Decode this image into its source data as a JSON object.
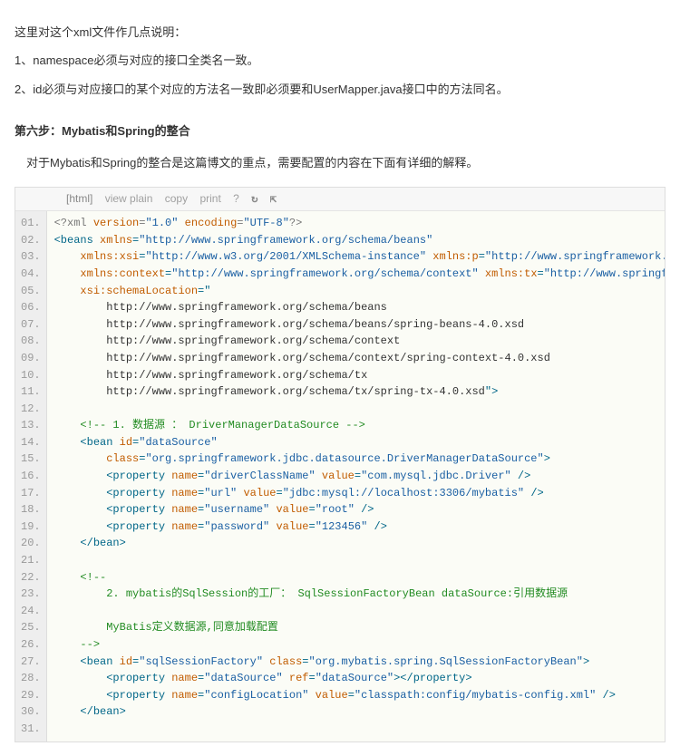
{
  "intro": {
    "line1": "这里对这个xml文件作几点说明：",
    "line2": "1、namespace必须与对应的接口全类名一致。",
    "line3": "2、id必须与对应接口的某个对应的方法名一致即必须要和UserMapper.java接口中的方法同名。"
  },
  "step_title": "第六步：Mybatis和Spring的整合",
  "step_desc": "对于Mybatis和Spring的整合是这篇博文的重点，需要配置的内容在下面有详细的解释。",
  "toolbar": {
    "lang": "[html]",
    "view": "view plain",
    "copy": "copy",
    "print": "print",
    "q": "?",
    "icon1": "↻",
    "icon2": "⇱"
  },
  "code": [
    {
      "n": "01.",
      "tokens": [
        {
          "c": "t-pi",
          "t": "<?xml "
        },
        {
          "c": "t-att",
          "t": "version"
        },
        {
          "c": "t-pi",
          "t": "="
        },
        {
          "c": "t-str",
          "t": "\"1.0\""
        },
        {
          "c": "t-pi",
          "t": " "
        },
        {
          "c": "t-att",
          "t": "encoding"
        },
        {
          "c": "t-pi",
          "t": "="
        },
        {
          "c": "t-str",
          "t": "\"UTF-8\""
        },
        {
          "c": "t-pi",
          "t": "?>"
        }
      ]
    },
    {
      "n": "02.",
      "tokens": [
        {
          "c": "t-tag",
          "t": "<beans "
        },
        {
          "c": "t-att",
          "t": "xmlns"
        },
        {
          "c": "t-tag",
          "t": "="
        },
        {
          "c": "t-str",
          "t": "\"http://www.springframework.org/schema/beans\""
        }
      ]
    },
    {
      "n": "03.",
      "tokens": [
        {
          "c": "",
          "t": "    "
        },
        {
          "c": "t-att",
          "t": "xmlns:xsi"
        },
        {
          "c": "t-tag",
          "t": "="
        },
        {
          "c": "t-str",
          "t": "\"http://www.w3.org/2001/XMLSchema-instance\""
        },
        {
          "c": "",
          "t": " "
        },
        {
          "c": "t-att",
          "t": "xmlns:p"
        },
        {
          "c": "t-tag",
          "t": "="
        },
        {
          "c": "t-str",
          "t": "\"http://www.springframework.org/schema/p\""
        }
      ]
    },
    {
      "n": "04.",
      "tokens": [
        {
          "c": "",
          "t": "    "
        },
        {
          "c": "t-att",
          "t": "xmlns:context"
        },
        {
          "c": "t-tag",
          "t": "="
        },
        {
          "c": "t-str",
          "t": "\"http://www.springframework.org/schema/context\""
        },
        {
          "c": "",
          "t": " "
        },
        {
          "c": "t-att",
          "t": "xmlns:tx"
        },
        {
          "c": "t-tag",
          "t": "="
        },
        {
          "c": "t-str",
          "t": "\"http://www.springframework.org/schema/tx\""
        }
      ]
    },
    {
      "n": "05.",
      "tokens": [
        {
          "c": "",
          "t": "    "
        },
        {
          "c": "t-att",
          "t": "xsi:schemaLocation"
        },
        {
          "c": "t-tag",
          "t": "=\""
        }
      ]
    },
    {
      "n": "06.",
      "tokens": [
        {
          "c": "",
          "t": "        http://www.springframework.org/schema/beans"
        }
      ]
    },
    {
      "n": "07.",
      "tokens": [
        {
          "c": "",
          "t": "        http://www.springframework.org/schema/beans/spring-beans-4.0.xsd"
        }
      ]
    },
    {
      "n": "08.",
      "tokens": [
        {
          "c": "",
          "t": "        http://www.springframework.org/schema/context"
        }
      ]
    },
    {
      "n": "09.",
      "tokens": [
        {
          "c": "",
          "t": "        http://www.springframework.org/schema/context/spring-context-4.0.xsd"
        }
      ]
    },
    {
      "n": "10.",
      "tokens": [
        {
          "c": "",
          "t": "        http://www.springframework.org/schema/tx"
        }
      ]
    },
    {
      "n": "11.",
      "tokens": [
        {
          "c": "",
          "t": "        http://www.springframework.org/schema/tx/spring-tx-4.0.xsd"
        },
        {
          "c": "t-tag",
          "t": "\">"
        }
      ]
    },
    {
      "n": "12.",
      "tokens": [
        {
          "c": "",
          "t": ""
        }
      ]
    },
    {
      "n": "13.",
      "tokens": [
        {
          "c": "",
          "t": "    "
        },
        {
          "c": "t-com",
          "t": "<!-- 1. 数据源 ： DriverManagerDataSource -->"
        }
      ]
    },
    {
      "n": "14.",
      "tokens": [
        {
          "c": "",
          "t": "    "
        },
        {
          "c": "t-tag",
          "t": "<bean "
        },
        {
          "c": "t-att",
          "t": "id"
        },
        {
          "c": "t-tag",
          "t": "="
        },
        {
          "c": "t-str",
          "t": "\"dataSource\""
        }
      ]
    },
    {
      "n": "15.",
      "tokens": [
        {
          "c": "",
          "t": "        "
        },
        {
          "c": "t-att",
          "t": "class"
        },
        {
          "c": "t-tag",
          "t": "="
        },
        {
          "c": "t-str",
          "t": "\"org.springframework.jdbc.datasource.DriverManagerDataSource\""
        },
        {
          "c": "t-tag",
          "t": ">"
        }
      ]
    },
    {
      "n": "16.",
      "tokens": [
        {
          "c": "",
          "t": "        "
        },
        {
          "c": "t-tag",
          "t": "<property "
        },
        {
          "c": "t-att",
          "t": "name"
        },
        {
          "c": "t-tag",
          "t": "="
        },
        {
          "c": "t-str",
          "t": "\"driverClassName\""
        },
        {
          "c": "",
          "t": " "
        },
        {
          "c": "t-att",
          "t": "value"
        },
        {
          "c": "t-tag",
          "t": "="
        },
        {
          "c": "t-str",
          "t": "\"com.mysql.jdbc.Driver\""
        },
        {
          "c": "t-tag",
          "t": " />"
        }
      ]
    },
    {
      "n": "17.",
      "tokens": [
        {
          "c": "",
          "t": "        "
        },
        {
          "c": "t-tag",
          "t": "<property "
        },
        {
          "c": "t-att",
          "t": "name"
        },
        {
          "c": "t-tag",
          "t": "="
        },
        {
          "c": "t-str",
          "t": "\"url\""
        },
        {
          "c": "",
          "t": " "
        },
        {
          "c": "t-att",
          "t": "value"
        },
        {
          "c": "t-tag",
          "t": "="
        },
        {
          "c": "t-str",
          "t": "\"jdbc:mysql://localhost:3306/mybatis\""
        },
        {
          "c": "t-tag",
          "t": " />"
        }
      ]
    },
    {
      "n": "18.",
      "tokens": [
        {
          "c": "",
          "t": "        "
        },
        {
          "c": "t-tag",
          "t": "<property "
        },
        {
          "c": "t-att",
          "t": "name"
        },
        {
          "c": "t-tag",
          "t": "="
        },
        {
          "c": "t-str",
          "t": "\"username\""
        },
        {
          "c": "",
          "t": " "
        },
        {
          "c": "t-att",
          "t": "value"
        },
        {
          "c": "t-tag",
          "t": "="
        },
        {
          "c": "t-str",
          "t": "\"root\""
        },
        {
          "c": "t-tag",
          "t": " />"
        }
      ]
    },
    {
      "n": "19.",
      "tokens": [
        {
          "c": "",
          "t": "        "
        },
        {
          "c": "t-tag",
          "t": "<property "
        },
        {
          "c": "t-att",
          "t": "name"
        },
        {
          "c": "t-tag",
          "t": "="
        },
        {
          "c": "t-str",
          "t": "\"password\""
        },
        {
          "c": "",
          "t": " "
        },
        {
          "c": "t-att",
          "t": "value"
        },
        {
          "c": "t-tag",
          "t": "="
        },
        {
          "c": "t-str",
          "t": "\"123456\""
        },
        {
          "c": "t-tag",
          "t": " />"
        }
      ]
    },
    {
      "n": "20.",
      "tokens": [
        {
          "c": "",
          "t": "    "
        },
        {
          "c": "t-tag",
          "t": "</bean>"
        }
      ]
    },
    {
      "n": "21.",
      "tokens": [
        {
          "c": "",
          "t": ""
        }
      ]
    },
    {
      "n": "22.",
      "tokens": [
        {
          "c": "",
          "t": "    "
        },
        {
          "c": "t-com",
          "t": "<!--"
        }
      ]
    },
    {
      "n": "23.",
      "tokens": [
        {
          "c": "",
          "t": "        "
        },
        {
          "c": "t-com",
          "t": "2. mybatis的SqlSession的工厂： SqlSessionFactoryBean dataSource:引用数据源"
        }
      ]
    },
    {
      "n": "24.",
      "tokens": [
        {
          "c": "",
          "t": ""
        }
      ]
    },
    {
      "n": "25.",
      "tokens": [
        {
          "c": "",
          "t": "        "
        },
        {
          "c": "t-com",
          "t": "MyBatis定义数据源,同意加载配置"
        }
      ]
    },
    {
      "n": "26.",
      "tokens": [
        {
          "c": "",
          "t": "    "
        },
        {
          "c": "t-com",
          "t": "-->"
        }
      ]
    },
    {
      "n": "27.",
      "tokens": [
        {
          "c": "",
          "t": "    "
        },
        {
          "c": "t-tag",
          "t": "<bean "
        },
        {
          "c": "t-att",
          "t": "id"
        },
        {
          "c": "t-tag",
          "t": "="
        },
        {
          "c": "t-str",
          "t": "\"sqlSessionFactory\""
        },
        {
          "c": "",
          "t": " "
        },
        {
          "c": "t-att",
          "t": "class"
        },
        {
          "c": "t-tag",
          "t": "="
        },
        {
          "c": "t-str",
          "t": "\"org.mybatis.spring.SqlSessionFactoryBean\""
        },
        {
          "c": "t-tag",
          "t": ">"
        }
      ]
    },
    {
      "n": "28.",
      "tokens": [
        {
          "c": "",
          "t": "        "
        },
        {
          "c": "t-tag",
          "t": "<property "
        },
        {
          "c": "t-att",
          "t": "name"
        },
        {
          "c": "t-tag",
          "t": "="
        },
        {
          "c": "t-str",
          "t": "\"dataSource\""
        },
        {
          "c": "",
          "t": " "
        },
        {
          "c": "t-att",
          "t": "ref"
        },
        {
          "c": "t-tag",
          "t": "="
        },
        {
          "c": "t-str",
          "t": "\"dataSource\""
        },
        {
          "c": "t-tag",
          "t": "></property>"
        }
      ]
    },
    {
      "n": "29.",
      "tokens": [
        {
          "c": "",
          "t": "        "
        },
        {
          "c": "t-tag",
          "t": "<property "
        },
        {
          "c": "t-att",
          "t": "name"
        },
        {
          "c": "t-tag",
          "t": "="
        },
        {
          "c": "t-str",
          "t": "\"configLocation\""
        },
        {
          "c": "",
          "t": " "
        },
        {
          "c": "t-att",
          "t": "value"
        },
        {
          "c": "t-tag",
          "t": "="
        },
        {
          "c": "t-str",
          "t": "\"classpath:config/mybatis-config.xml\""
        },
        {
          "c": "t-tag",
          "t": " />"
        }
      ]
    },
    {
      "n": "30.",
      "tokens": [
        {
          "c": "",
          "t": "    "
        },
        {
          "c": "t-tag",
          "t": "</bean>"
        }
      ]
    },
    {
      "n": "31.",
      "tokens": [
        {
          "c": "",
          "t": ""
        }
      ]
    }
  ]
}
